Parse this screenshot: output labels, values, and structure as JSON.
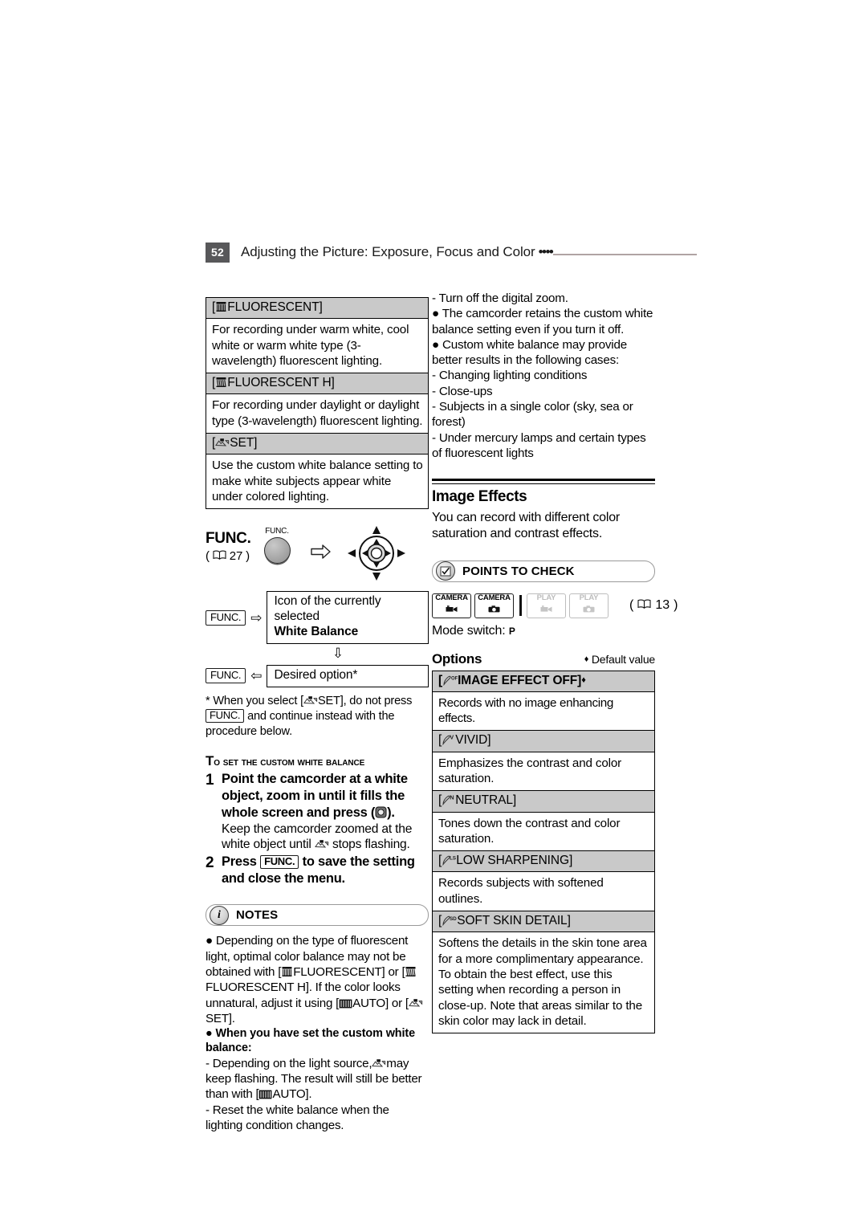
{
  "header": {
    "page_number": "52",
    "title": "Adjusting the Picture: Exposure, Focus and Color",
    "dots": "••••"
  },
  "left_column": {
    "wb_options": [
      {
        "icon": "fluorescent-icon",
        "label": "[  FLUORESCENT]",
        "label_text": "FLUORESCENT",
        "description": "For recording under warm white, cool white or warm white type (3-wavelength) fluorescent lighting."
      },
      {
        "icon": "fluorescent-h-icon",
        "label": "[  FLUORESCENT H]",
        "label_text": "FLUORESCENT H",
        "description": "For recording under daylight or daylight type (3-wavelength) fluorescent lighting."
      },
      {
        "icon": "custom-wb-set-icon",
        "label": "[  SET]",
        "label_text": "SET",
        "description": "Use the custom white balance setting to make white subjects appear white under colored lighting."
      }
    ],
    "func_diagram": {
      "func_word": "FUNC.",
      "page_ref": "27",
      "button_label": "FUNC.",
      "step1_tag": "FUNC.",
      "step1_arrow": "⇨",
      "step1_line1": "Icon of the currently selected",
      "step1_line2": "White Balance",
      "down_arrow": "⇩",
      "step2_tag": "FUNC.",
      "step2_arrow": "⇦",
      "step2_text": "Desired option*",
      "footnote_part1": "* When you select [",
      "footnote_part2": "SET], do not press",
      "footnote_tag": "FUNC.",
      "footnote_part3": "and continue instead with the",
      "footnote_part4": "procedure below."
    },
    "procedure": {
      "title": "To set the custom white balance",
      "steps": [
        {
          "num": "1",
          "bold_part1": "Point the camcorder at a white object, zoom in until it fills the whole screen and press (",
          "bold_part2": ").",
          "sub_text": "Keep the camcorder zoomed at the white object until",
          "sub_text_2": "stops flashing."
        },
        {
          "num": "2",
          "bold_part1": "Press",
          "tag": "FUNC.",
          "bold_part2": "to save the setting and close the menu."
        }
      ]
    },
    "notes": {
      "caption": "NOTES",
      "icon": "info-icon",
      "para1_a": "● Depending on the type of fluorescent light, optimal color balance may not be obtained with [",
      "para1_b": "FLUORESCENT] or [",
      "para1_c": "FLUORESCENT H]. If the color looks unnatural, adjust it using [",
      "para1_d": "AUTO] or [",
      "para1_e": "SET].",
      "para2_head": "● When you have set the custom white balance:",
      "para3_a": "- Depending on the light source,",
      "para3_b": "may keep flashing. The result will still be better than with [",
      "para3_c": "AUTO].",
      "para4": "- Reset the white balance when the lighting condition changes."
    }
  },
  "right_column": {
    "continued_notes": [
      "-  Turn off the digital zoom.",
      "● The camcorder retains the custom white balance setting even if you turn it off.",
      "● Custom white balance may provide better results in the following cases:",
      "-  Changing lighting conditions",
      "-  Close-ups",
      "-  Subjects in a single color (sky, sea or forest)",
      "-  Under mercury lamps and certain types of fluorescent lights"
    ],
    "section": {
      "title": "Image Effects",
      "intro": "You can record with different color saturation and contrast effects."
    },
    "points_to_check": {
      "caption": "POINTS TO CHECK",
      "icon": "checklist-icon",
      "modes": [
        {
          "name": "CAMERA",
          "sub_icon": "movie-camera-icon",
          "enabled": true
        },
        {
          "name": "CAMERA",
          "sub_icon": "still-camera-icon",
          "enabled": true
        },
        {
          "name": "PLAY",
          "sub_icon": "movie-camera-icon",
          "enabled": false
        },
        {
          "name": "PLAY",
          "sub_icon": "still-camera-icon",
          "enabled": false
        }
      ],
      "page_ref": "13",
      "mode_switch_label": "Mode switch:",
      "mode_switch_value": "P"
    },
    "options_label": "Options",
    "default_note": "Default value",
    "default_marker": "♦",
    "options": [
      {
        "icon": "image-effect-off-icon",
        "label": "[  IMAGE EFFECT OFF]",
        "label_text": "IMAGE EFFECT OFF",
        "is_default": true,
        "description": "Records with no image enhancing effects."
      },
      {
        "icon": "vivid-icon",
        "label": "[  VIVID]",
        "label_text": "VIVID",
        "is_default": false,
        "description": "Emphasizes the contrast and color saturation."
      },
      {
        "icon": "neutral-icon",
        "label": "[  NEUTRAL]",
        "label_text": "NEUTRAL",
        "is_default": false,
        "description": "Tones down the contrast and color saturation."
      },
      {
        "icon": "low-sharpening-icon",
        "label": "[  LOW SHARPENING]",
        "label_text": "LOW SHARPENING",
        "is_default": false,
        "description": "Records subjects with softened outlines."
      },
      {
        "icon": "soft-skin-detail-icon",
        "label": "[  SOFT SKIN DETAIL]",
        "label_text": "SOFT SKIN DETAIL",
        "is_default": false,
        "description": "Softens the details in the skin tone area for a more complimentary appearance. To obtain the best effect, use this setting when recording a person in close-up. Note that areas similar to the skin color may lack in detail."
      }
    ]
  }
}
